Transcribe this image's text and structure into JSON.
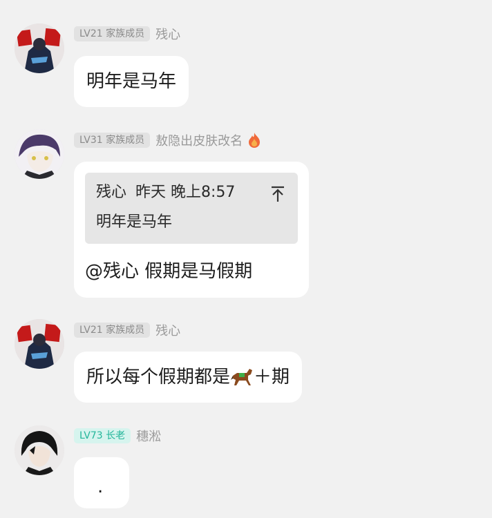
{
  "messages": [
    {
      "level": "LV21 家族成员",
      "username": "残心",
      "text": "明年是马年"
    },
    {
      "level": "LV31 家族成员",
      "username": "敖隐出皮肤改名",
      "user_icon": "flame-icon",
      "quote": {
        "author": "残心",
        "time": "昨天 晚上8:57",
        "text": "明年是马年"
      },
      "text": "@残心 假期是马假期"
    },
    {
      "level": "LV21 家族成员",
      "username": "残心",
      "text_before_emoji": "所以每个假期都是",
      "emoji": "horse-icon",
      "text_after_emoji": "＋期"
    },
    {
      "level": "LV73 长老",
      "username": "穗淞",
      "text": "."
    }
  ],
  "colors": {
    "background": "#f1f1f1",
    "bubble": "#ffffff",
    "quote_background": "#e6e6e6",
    "member_badge_bg": "#e2e2e2",
    "elder_badge_bg": "#d6f4ee",
    "elder_badge_text": "#23b69a"
  }
}
